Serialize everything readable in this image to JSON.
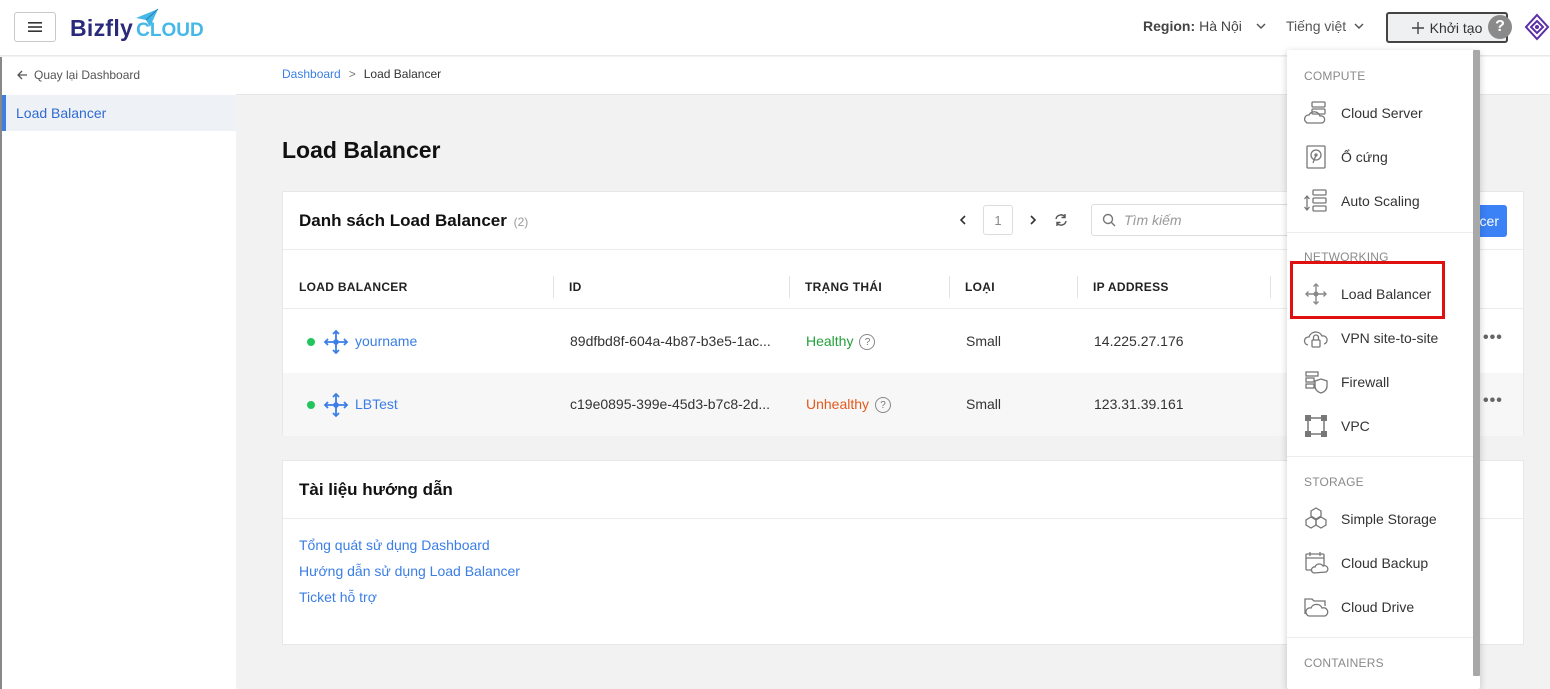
{
  "topbar": {
    "logo_main": "Bizfly",
    "logo_sub": "CLOUD",
    "region_label": "Region:",
    "region_value": "Hà Nội",
    "language": "Tiếng việt",
    "create_label": "Khởi tạo",
    "help_label": "?"
  },
  "sidebar": {
    "back_label": "Quay lại Dashboard",
    "items": [
      {
        "label": "Load Balancer",
        "active": true
      }
    ]
  },
  "breadcrumb": {
    "items": [
      "Dashboard",
      "Load Balancer"
    ],
    "separator": ">"
  },
  "page_title": "Load Balancer",
  "lb_list": {
    "title": "Danh sách Load Balancer",
    "count": "(2)",
    "page": "1",
    "search_placeholder": "Tìm kiếm",
    "create_button": "cer",
    "columns": [
      "LOAD BALANCER",
      "ID",
      "TRẠNG THÁI",
      "LOẠI",
      "IP ADDRESS"
    ],
    "rows": [
      {
        "name": "yourname",
        "id": "89dfbd8f-604a-4b87-b3e5-1ac...",
        "status": "Healthy",
        "type": "Small",
        "ip": "14.225.27.176",
        "more": "•••"
      },
      {
        "name": "LBTest",
        "id": "c19e0895-399e-45d3-b7c8-2d...",
        "status": "Unhealthy",
        "type": "Small",
        "ip": "123.31.39.161",
        "more": "•••"
      }
    ]
  },
  "docs": {
    "title": "Tài liệu hướng dẫn",
    "links": [
      "Tổng quát sử dụng Dashboard",
      "Hướng dẫn sử dụng Load Balancer",
      "Ticket hỗ trợ"
    ]
  },
  "create_menu": {
    "sections": [
      {
        "title": "COMPUTE",
        "items": [
          {
            "label": "Cloud Server",
            "icon": "cloud-server-icon"
          },
          {
            "label": "Ổ cứng",
            "icon": "disk-icon"
          },
          {
            "label": "Auto Scaling",
            "icon": "auto-scaling-icon"
          }
        ]
      },
      {
        "title": "NETWORKING",
        "items": [
          {
            "label": "Load Balancer",
            "icon": "load-balancer-icon",
            "highlighted": true
          },
          {
            "label": "VPN site-to-site",
            "icon": "vpn-icon"
          },
          {
            "label": "Firewall",
            "icon": "firewall-icon"
          },
          {
            "label": "VPC",
            "icon": "vpc-icon"
          }
        ]
      },
      {
        "title": "STORAGE",
        "items": [
          {
            "label": "Simple Storage",
            "icon": "simple-storage-icon"
          },
          {
            "label": "Cloud Backup",
            "icon": "cloud-backup-icon"
          },
          {
            "label": "Cloud Drive",
            "icon": "cloud-drive-icon"
          }
        ]
      },
      {
        "title": "CONTAINERS",
        "items": []
      }
    ]
  },
  "colors": {
    "accent": "#3b82f6",
    "link": "#3a7ee6",
    "healthy": "#22a03a",
    "unhealthy": "#e25a1c",
    "highlight": "#e01010"
  }
}
